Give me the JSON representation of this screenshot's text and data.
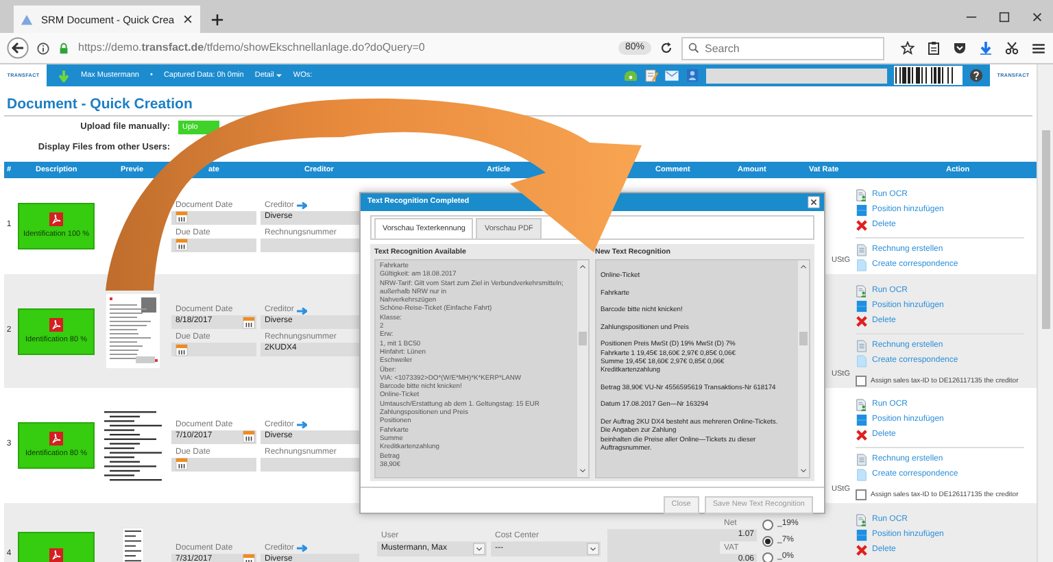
{
  "browser": {
    "tab_title": "SRM Document - Quick Crea",
    "url": "https://demo.**transfact.de**/tfdemo/showEkschnellanlage.do?doQuery=0",
    "zoom": "80%",
    "search_placeholder": "Search"
  },
  "app_bar": {
    "logo_left": "TRANSFACT",
    "user": "Max Mustermann",
    "separator": "•",
    "captured": "Captured Data: 0h 0min",
    "detail": "Detail",
    "wos": "WOs:",
    "logo_right": "TRANSFACT"
  },
  "page_title": "Document - Quick Creation",
  "upload": {
    "label": "Upload file manually:",
    "button": "Uplo"
  },
  "display_files": {
    "label": "Display Files from other Users:"
  },
  "table": {
    "columns": [
      "#",
      "Description",
      "Previe",
      "ate",
      "Creditor",
      "Article",
      "Comment",
      "Amount",
      "Vat Rate",
      "Action"
    ],
    "rows": [
      {
        "number": "1",
        "identification": "Identification 100 %",
        "date_fields": [
          {
            "label": "Document Date"
          },
          {
            "label": "Due Date"
          }
        ],
        "creditor_fields": [
          {
            "kind": "link",
            "label": "Creditor",
            "value": "Diverse"
          },
          {
            "kind": "plain",
            "label": "Rechnungsnummer"
          }
        ],
        "tax_law": "UStG",
        "action_groups": [
          [
            {
              "kind": "ocr",
              "label": "Run OCR"
            },
            {
              "kind": "position",
              "label": "Position hinzufügen"
            },
            {
              "kind": "delete",
              "label": "Delete"
            }
          ],
          [
            {
              "kind": "invoice",
              "label": "Rechnung erstellen"
            },
            {
              "kind": "correspondence",
              "label": "Create correspondence"
            }
          ]
        ]
      },
      {
        "number": "2",
        "identification": "Identification 80 %",
        "preview": {
          "kind": "document"
        },
        "date_fields": [
          {
            "label": "Document Date",
            "value": "8/18/2017"
          },
          {
            "label": "Due Date"
          }
        ],
        "creditor_fields": [
          {
            "kind": "link",
            "label": "Creditor",
            "value": "Diverse"
          },
          {
            "kind": "plain",
            "label": "Rechnungsnummer",
            "value": "2KUDX4"
          }
        ],
        "tax_law": "UStG",
        "action_groups": [
          [
            {
              "kind": "ocr",
              "label": "Run OCR"
            },
            {
              "kind": "position",
              "label": "Position hinzufügen"
            },
            {
              "kind": "delete",
              "label": "Delete"
            }
          ],
          [
            {
              "kind": "invoice",
              "label": "Rechnung erstellen"
            },
            {
              "kind": "correspondence",
              "label": "Create correspondence"
            }
          ]
        ],
        "assign_tax": {
          "label": "Assign sales tax-ID to DE126117135 the creditor",
          "checked": false
        }
      },
      {
        "number": "3",
        "identification": "Identification 80 %",
        "preview": {
          "kind": "receipt"
        },
        "date_fields": [
          {
            "label": "Document Date",
            "value": "7/10/2017"
          },
          {
            "label": "Due Date"
          }
        ],
        "creditor_fields": [
          {
            "kind": "link",
            "label": "Creditor",
            "value": "Diverse"
          },
          {
            "kind": "plain",
            "label": "Rechnungsnummer"
          }
        ],
        "tax_law": "UStG",
        "action_groups": [
          [
            {
              "kind": "ocr",
              "label": "Run OCR"
            },
            {
              "kind": "position",
              "label": "Position hinzufügen"
            },
            {
              "kind": "delete",
              "label": "Delete"
            }
          ],
          [
            {
              "kind": "invoice",
              "label": "Rechnung erstellen"
            },
            {
              "kind": "correspondence",
              "label": "Create correspondence"
            }
          ]
        ],
        "assign_tax": {
          "label": "Assign sales tax-ID to DE126117135 the creditor",
          "checked": false
        }
      },
      {
        "number": "4",
        "preview": {
          "kind": "ticket"
        },
        "date_fields": [
          {
            "label": "Document Date",
            "value": "7/31/2017"
          }
        ],
        "creditor_fields": [
          {
            "kind": "link",
            "label": "Creditor",
            "value": "Diverse"
          }
        ],
        "user": {
          "label": "User",
          "value": "Mustermann, Max"
        },
        "cost_center": {
          "label": "Cost Center",
          "value": "---"
        },
        "net": {
          "label": "Net",
          "value": "1.07"
        },
        "vat": {
          "label": "VAT",
          "value": "0.06"
        },
        "vat_rates": [
          {
            "label": "_19%",
            "selected": false
          },
          {
            "label": "_7%",
            "selected": true
          },
          {
            "label": "_0%",
            "selected": false
          }
        ],
        "action_groups": [
          [
            {
              "kind": "ocr",
              "label": "Run OCR"
            },
            {
              "kind": "position",
              "label": "Position hinzufügen"
            },
            {
              "kind": "delete",
              "label": "Delete"
            }
          ]
        ]
      }
    ]
  },
  "dialog": {
    "title": "Text Recognition Completed",
    "tabs": [
      {
        "label": "Vorschau Texterkennung",
        "selected": true
      },
      {
        "label": "Vorschau PDF",
        "selected": false
      }
    ],
    "available": {
      "title": "Text Recognition Available",
      "lines": [
        "Fahrkarte",
        "Gültigkeit: am 18.08.2017",
        "NRW-Tarif: Gilt vom Start zum Ziel in Verbundverkehrsmitteln;",
        "außerhalb NRW nur in",
        "Nahverkehrszügen",
        "Schöne-Reise-Ticket (Einfache Fahrt)",
        "Klasse:",
        "2",
        "Erw:",
        "1, mit 1 BC50",
        "Hinfahrt: Lünen",
        "Eschweiler",
        "Über:",
        "VIA: <1073392>DO*(W/E*MH)*K*KERP*LANW",
        "Barcode bitte nicht knicken!",
        "Online-Ticket",
        "Umtausch/Erstattung ab dem 1. Geltungstag: 15 EUR",
        "Zahlungspositionen und Preis",
        "Positionen",
        "Fahrkarte",
        "Summe",
        "Kreditkartenzahlung",
        "Betrag",
        "38,90€"
      ]
    },
    "new": {
      "title": "New Text Recognition",
      "paragraphs": [
        [
          "Online-Ticket"
        ],
        [
          "Fahrkarte"
        ],
        [
          "Barcode bitte nicht knicken!"
        ],
        [
          "Zahlungspositionen und Preis"
        ],
        [
          "Positionen Preis MwSt (D) 19% MwSt (D) 7%",
          "Fahrkarte 1 19,45€ 18,60€ 2,97€ 0,85€ 0,06€",
          "Summe 19,45€ 18,60€ 2,97€ 0,85€ 0,06€",
          "Kreditkartenzahlung"
        ],
        [
          "Betrag 38,90€ VU-Nr 4556595619 Transaktions-Nr 618174"
        ],
        [
          "Datum 17.08.2017 Gen—Nr 163294"
        ],
        [
          "Der Auftrag 2KU DX4 besteht aus mehreren Online-Tickets.",
          "Die Angaben zur Zahlung",
          "beinhalten die Preise aller Online—Tickets zu dieser",
          "Auftragsnummer."
        ]
      ]
    },
    "buttons": [
      "Close",
      "Save New Text Recognition"
    ]
  }
}
